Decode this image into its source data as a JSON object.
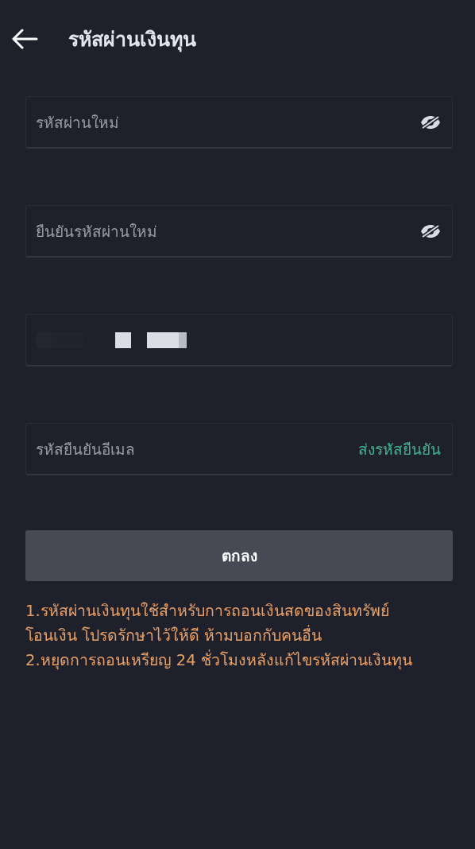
{
  "header": {
    "title": "รหัสผ่านเงินทุน"
  },
  "fields": [
    {
      "kind": "password",
      "placeholder": "รหัสผ่านใหม่"
    },
    {
      "kind": "password",
      "placeholder": "ยืนยันรหัสผ่านใหม่"
    },
    {
      "kind": "redacted"
    },
    {
      "kind": "code",
      "placeholder": "รหัสยืนยันอีเมล",
      "action": "ส่งรหัสยืนยัน"
    }
  ],
  "submit": "ตกลง",
  "notes": [
    "1.รหัสผ่านเงินทุนใช้สำหรับการถอนเงินสดของสินทรัพย์โอนเงิน โปรดรักษาไว้ให้ดี ห้ามบอกกับคนอื่น",
    "2.หยุดการถอนเหรียญ 24 ชั่วโมงหลังแก้ไขรหัสผ่านเงินทุน"
  ]
}
